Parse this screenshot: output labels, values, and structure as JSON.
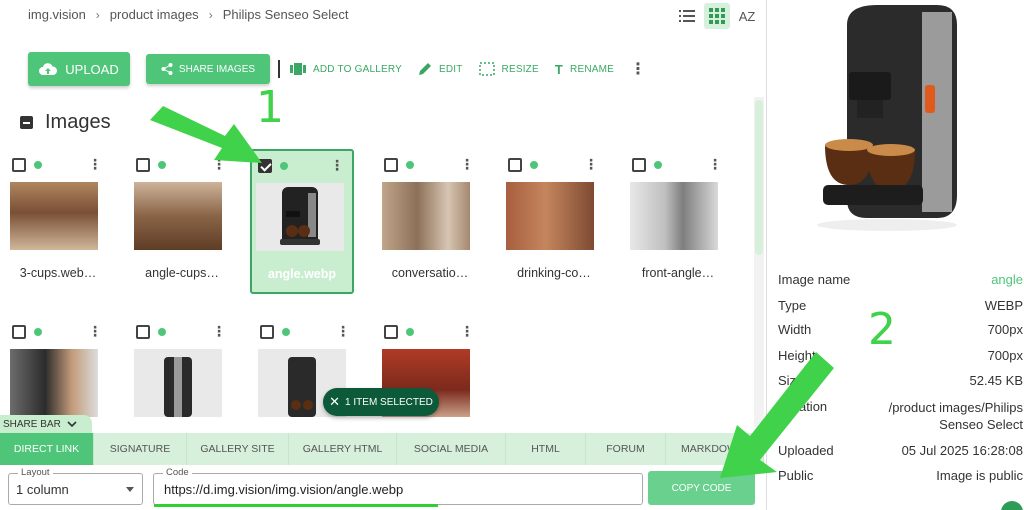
{
  "breadcrumb": [
    "img.vision",
    "product images",
    "Philips Senseo Select"
  ],
  "breadcrumb_sep": "›",
  "view_icons": [
    "list-icon",
    "grid-icon",
    "sort-az-icon"
  ],
  "sort_label": "AZ",
  "toolbar": {
    "upload": "UPLOAD",
    "share_images": "SHARE IMAGES",
    "add_to_gallery": "ADD TO GALLERY",
    "edit": "EDIT",
    "resize": "RESIZE",
    "rename": "RENAME"
  },
  "section_title": "Images",
  "images": [
    {
      "name": "3-cups.web…",
      "checked": false,
      "selected": false
    },
    {
      "name": "angle-cups…",
      "checked": false,
      "selected": false
    },
    {
      "name": "angle.webp",
      "checked": true,
      "selected": true
    },
    {
      "name": "conversatio…",
      "checked": false,
      "selected": false
    },
    {
      "name": "drinking-co…",
      "checked": false,
      "selected": false
    },
    {
      "name": "front-angle…",
      "checked": false,
      "selected": false
    },
    {
      "name": "",
      "checked": false,
      "selected": false
    },
    {
      "name": "",
      "checked": false,
      "selected": false
    },
    {
      "name": "",
      "checked": false,
      "selected": false
    },
    {
      "name": "",
      "checked": false,
      "selected": false
    }
  ],
  "selection_pill": "1 ITEM SELECTED",
  "share_bar": {
    "label": "SHARE BAR",
    "tabs": [
      "DIRECT LINK",
      "SIGNATURE",
      "GALLERY SITE",
      "GALLERY HTML",
      "SOCIAL MEDIA",
      "HTML",
      "FORUM",
      "MARKDOWN"
    ],
    "active_tab": "DIRECT LINK",
    "layout_label": "Layout",
    "layout_value": "1 column",
    "code_label": "Code",
    "code_value": "https://d.img.vision/img.vision/angle.webp",
    "copy_button": "COPY CODE"
  },
  "details": {
    "rows": [
      {
        "key": "Image name",
        "value": "angle"
      },
      {
        "key": "Type",
        "value": "WEBP"
      },
      {
        "key": "Width",
        "value": "700px"
      },
      {
        "key": "Height",
        "value": "700px"
      },
      {
        "key": "Size",
        "value": "52.45 KB"
      },
      {
        "key": "Location",
        "value": "/product images/Philips Senseo Select"
      },
      {
        "key": "Uploaded",
        "value": "05 Jul 2025 16:28:08"
      },
      {
        "key": "Public",
        "value": "Image is public"
      }
    ]
  },
  "annotations": {
    "one": "1",
    "two": "2"
  },
  "colors": {
    "accent": "#4fc57a",
    "accent_light": "#d7f0dc",
    "arrow": "#3fd24a",
    "pill": "#0d5a3a"
  }
}
